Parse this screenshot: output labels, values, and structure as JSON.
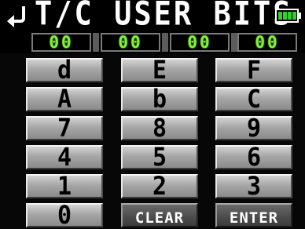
{
  "header": {
    "title": "T/C USER BITS",
    "back_icon": "return-arrow-icon",
    "battery_icon": "battery-icon",
    "battery_color": "#33cc33",
    "battery_level": 1.0
  },
  "bits": {
    "digit_color": "#86ef3c",
    "fields": [
      "00",
      "00",
      "00",
      "00"
    ]
  },
  "keypad": {
    "rows": [
      [
        "d",
        "E",
        "F"
      ],
      [
        "A",
        "b",
        "C"
      ],
      [
        "7",
        "8",
        "9"
      ],
      [
        "4",
        "5",
        "6"
      ],
      [
        "1",
        "2",
        "3"
      ],
      [
        "0",
        "CLEAR",
        "ENTER"
      ]
    ]
  }
}
